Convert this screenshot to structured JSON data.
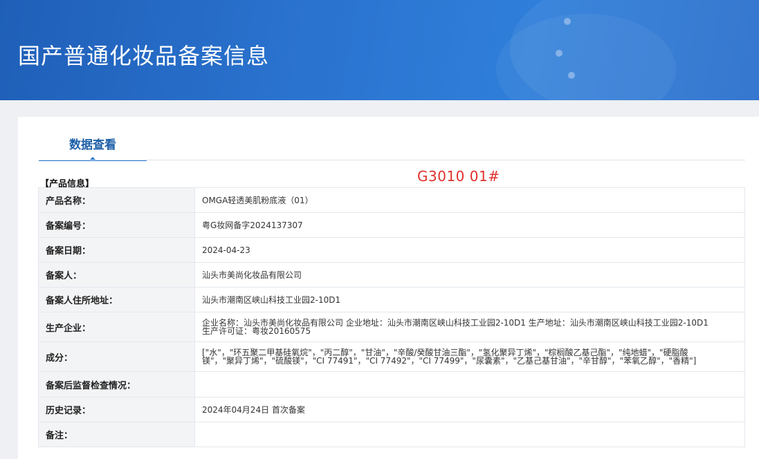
{
  "banner": {
    "title": "国产普通化妆品备案信息"
  },
  "tab": {
    "label": "数据查看"
  },
  "section": {
    "label": "【产品信息】"
  },
  "annotation": {
    "text": "G3010 01#",
    "color": "#e0302c"
  },
  "colors": {
    "banner_blue": "#2a73cf",
    "tab_blue": "#2a7ad1",
    "label_bg": "#f3f4f6",
    "table_border": "#a9c4e2"
  },
  "rows": [
    {
      "label": "产品名称：",
      "value": "OMGA轻透美肌粉底液（01）"
    },
    {
      "label": "备案编号：",
      "value": "粤G妆网备字2024137307"
    },
    {
      "label": "备案日期：",
      "value": "2024-04-23"
    },
    {
      "label": "备案人：",
      "value": "汕头市美尚化妆品有限公司"
    },
    {
      "label": "备案人住所地址：",
      "value": "汕头市潮南区峡山科技工业园2-10D1"
    },
    {
      "label": "生产企业：",
      "value": "企业名称：汕头市美尚化妆品有限公司 企业地址：汕头市潮南区峡山科技工业园2-10D1 生产地址：汕头市潮南区峡山科技工业园2-10D1",
      "value2": "生产许可证：粤妆20160575"
    },
    {
      "label": "成分：",
      "value": "[\"水\"，\"环五聚二甲基硅氧烷\"，\"丙二醇\"，\"甘油\"，\"辛酸/癸酸甘油三酯\"，\"氢化聚异丁烯\"，\"棕榈酸乙基己酯\"，\"纯地蜡\"，\"硬脂酸",
      "value2": "镁\"，\"聚异丁烯\"，\"硫酸镁\"，\"CI 77491\"，\"CI 77492\"，\"CI 77499\"，\"尿囊素\"，\"乙基己基甘油\"，\"辛甘醇\"，\"苯氧乙醇\"，\"香精\"]"
    },
    {
      "label": "备案后监督检查情况：",
      "value": ""
    },
    {
      "label": "历史记录：",
      "value": "2024年04月24日 首次备案"
    },
    {
      "label": "备注：",
      "value": ""
    }
  ]
}
